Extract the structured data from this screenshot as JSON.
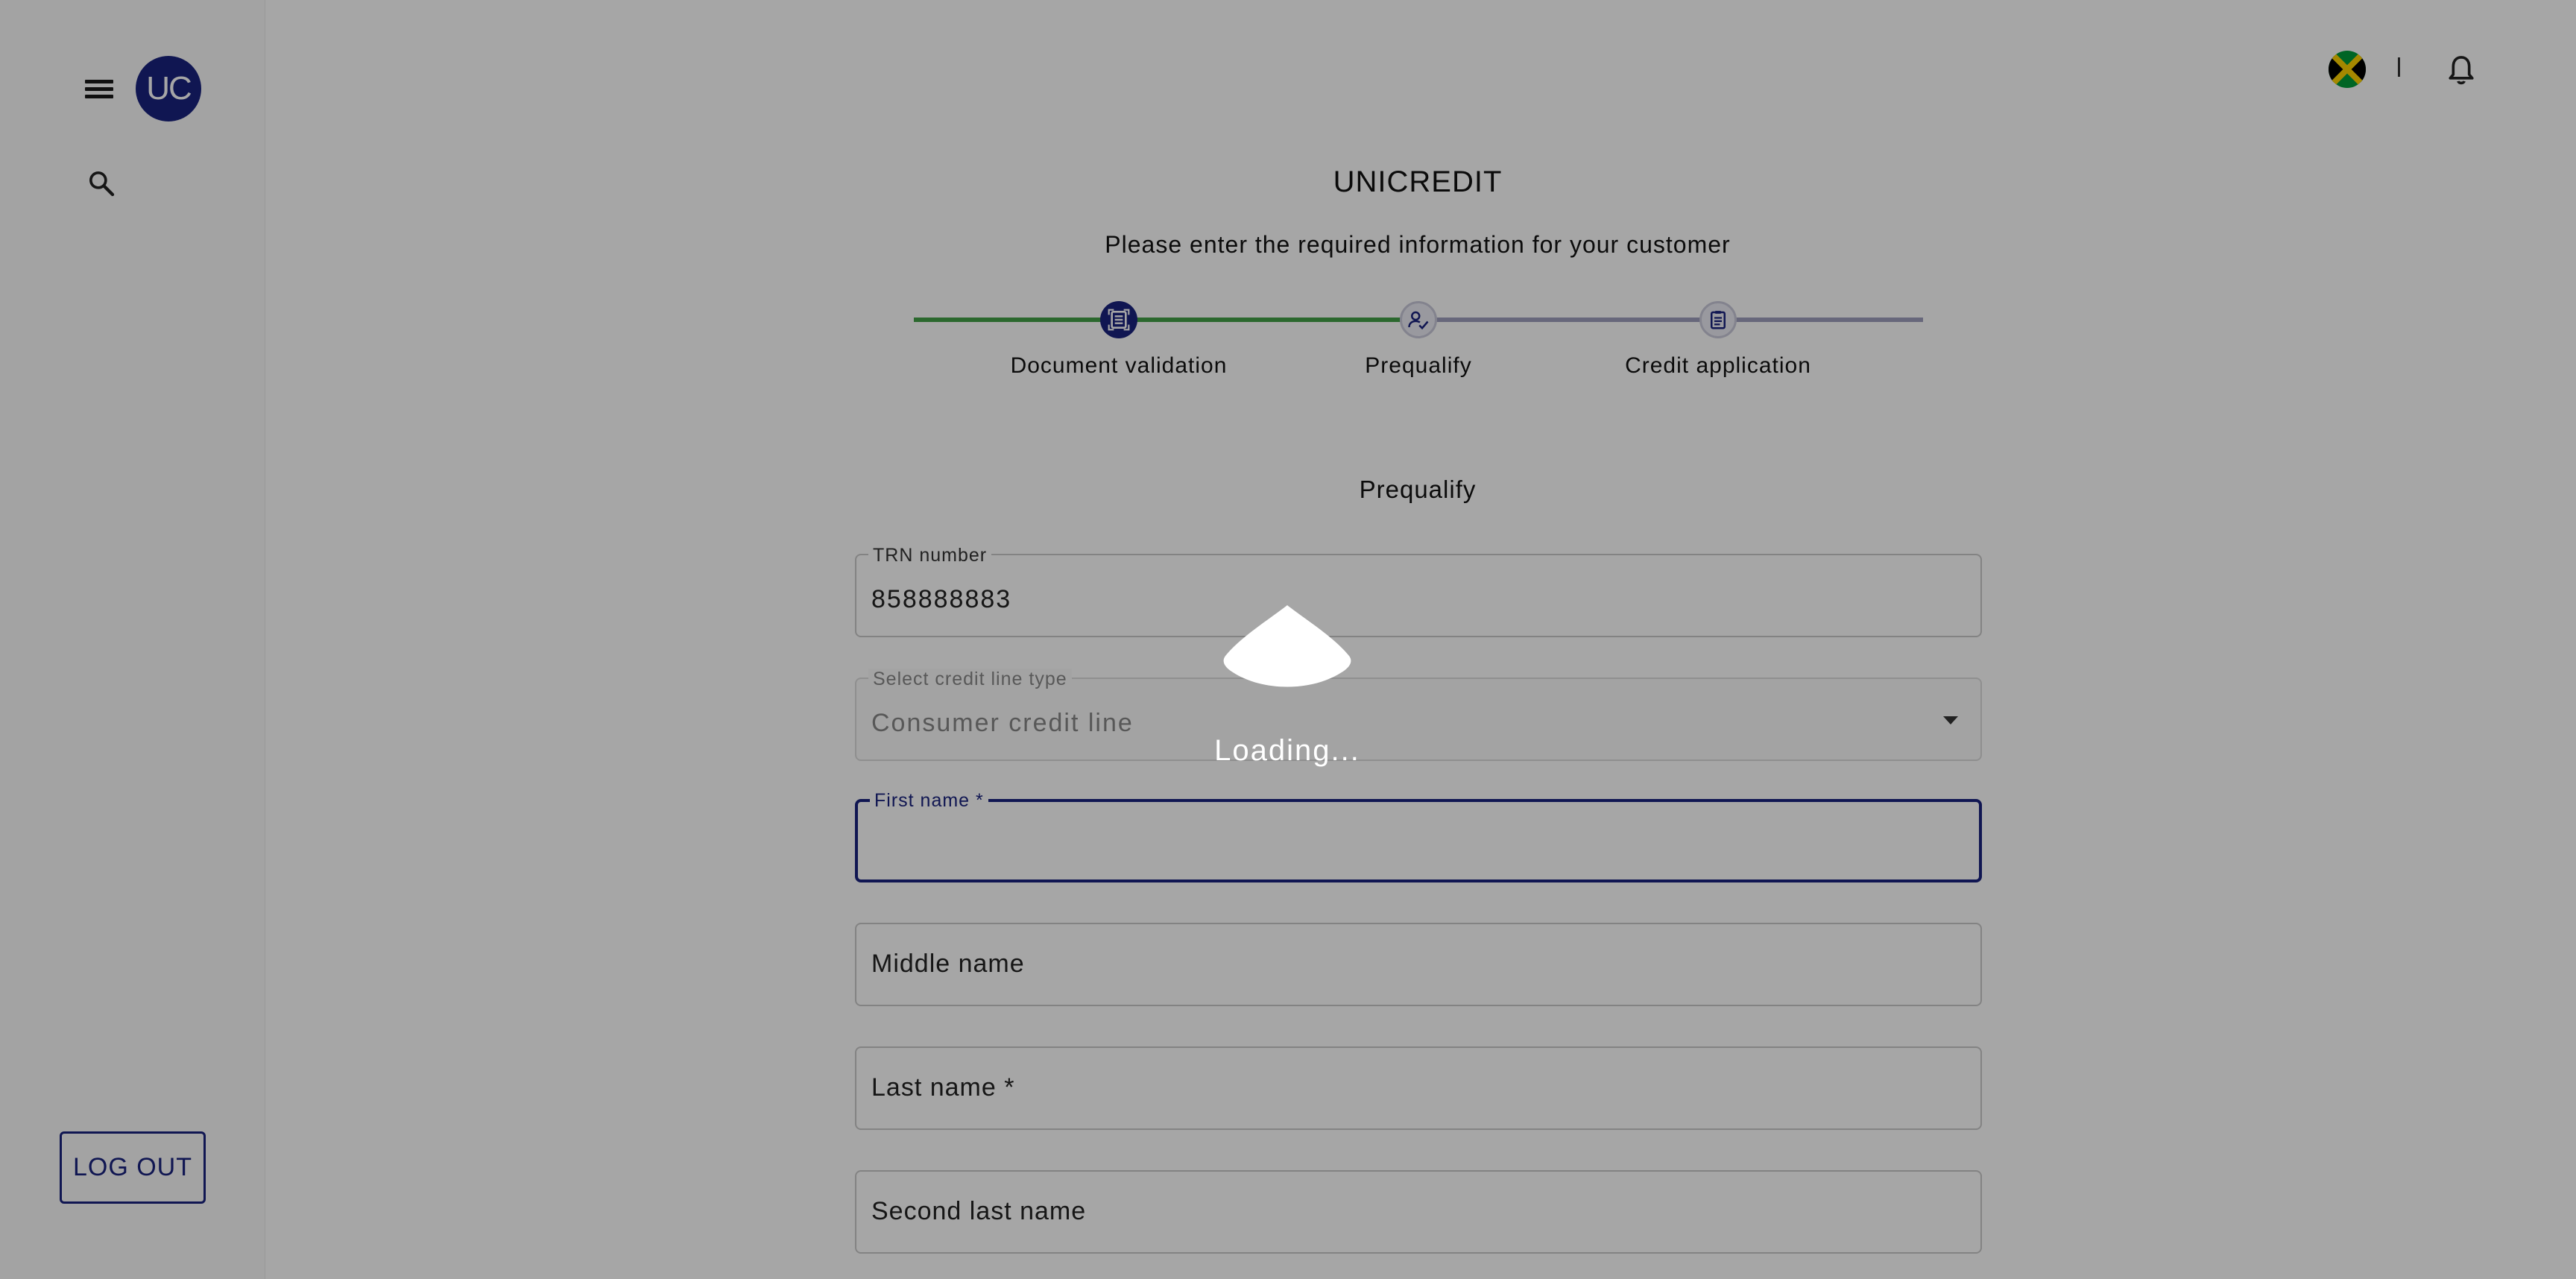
{
  "sidebar": {
    "avatar_initials": "UC",
    "logout_label": "LOG OUT"
  },
  "header": {
    "country_flag": "jamaica-flag-icon"
  },
  "main": {
    "title": "UNICREDIT",
    "subtitle": "Please enter the required information for your customer",
    "section_title": "Prequalify",
    "steps": [
      {
        "label": "Document validation",
        "status": "complete"
      },
      {
        "label": "Prequalify",
        "status": "current"
      },
      {
        "label": "Credit application",
        "status": "pending"
      }
    ],
    "progress_fraction": 0.5
  },
  "form": {
    "trn": {
      "label": "TRN number",
      "value": "858888883"
    },
    "credit_line": {
      "label": "Select credit line type",
      "value": "Consumer credit line"
    },
    "first_name": {
      "label": "First name *",
      "value": ""
    },
    "middle_name": {
      "placeholder": "Middle name"
    },
    "last_name": {
      "placeholder": "Last name *"
    },
    "second_last_name": {
      "placeholder": "Second last name"
    }
  },
  "overlay": {
    "loading_text": "Loading..."
  },
  "colors": {
    "primary": "#1a237e",
    "progress_complete": "#43a047",
    "progress_pending": "#9e9ebe"
  }
}
